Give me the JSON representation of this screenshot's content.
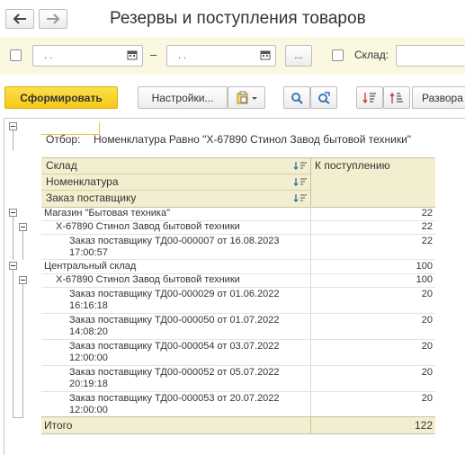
{
  "window": {
    "title": "Резервы и поступления товаров"
  },
  "period": {
    "start": ". .",
    "end": ". .",
    "dash": "–",
    "more": "..."
  },
  "warehouse": {
    "label": "Склад:",
    "value": ""
  },
  "toolbar": {
    "generate": "Сформировать",
    "settings": "Настройки...",
    "expand": "Развора"
  },
  "report": {
    "filter_label": "Отбор:",
    "filter_value": "Номенклатура Равно \"X-67890 Стинол Завод бытовой техники\"",
    "headers": [
      "Склад",
      "Номенклатура",
      "Заказ поставщику"
    ],
    "value_header": "К поступлению",
    "rows": [
      {
        "level": 0,
        "line1": "Магазин \"Бытовая техника\"",
        "line2": "",
        "value": "22"
      },
      {
        "level": 1,
        "line1": "X-67890 Стинол Завод бытовой техники",
        "line2": "",
        "value": "22"
      },
      {
        "level": 2,
        "line1": "Заказ поставщику ТД00-000007 от 16.08.2023",
        "line2": "17:00:57",
        "value": "22"
      },
      {
        "level": 0,
        "line1": "Центральный склад",
        "line2": "",
        "value": "100"
      },
      {
        "level": 1,
        "line1": "X-67890 Стинол Завод бытовой техники",
        "line2": "",
        "value": "100"
      },
      {
        "level": 2,
        "line1": "Заказ поставщику ТД00-000029 от 01.06.2022",
        "line2": "16:16:18",
        "value": "20"
      },
      {
        "level": 2,
        "line1": "Заказ поставщику ТД00-000050 от 01.07.2022",
        "line2": "14:08:20",
        "value": "20"
      },
      {
        "level": 2,
        "line1": "Заказ поставщику ТД00-000054 от 03.07.2022",
        "line2": "12:00:00",
        "value": "20"
      },
      {
        "level": 2,
        "line1": "Заказ поставщику ТД00-000052 от 05.07.2022",
        "line2": "20:19:18",
        "value": "20"
      },
      {
        "level": 2,
        "line1": "Заказ поставщику ТД00-000053 от 20.07.2022",
        "line2": "12:00:00",
        "value": "20"
      }
    ],
    "total_label": "Итого",
    "total_value": "122"
  },
  "colors": {
    "accent": "#f9d835",
    "header_bg": "#f4eed0",
    "toolbar_bg": "#fbf8e1"
  }
}
